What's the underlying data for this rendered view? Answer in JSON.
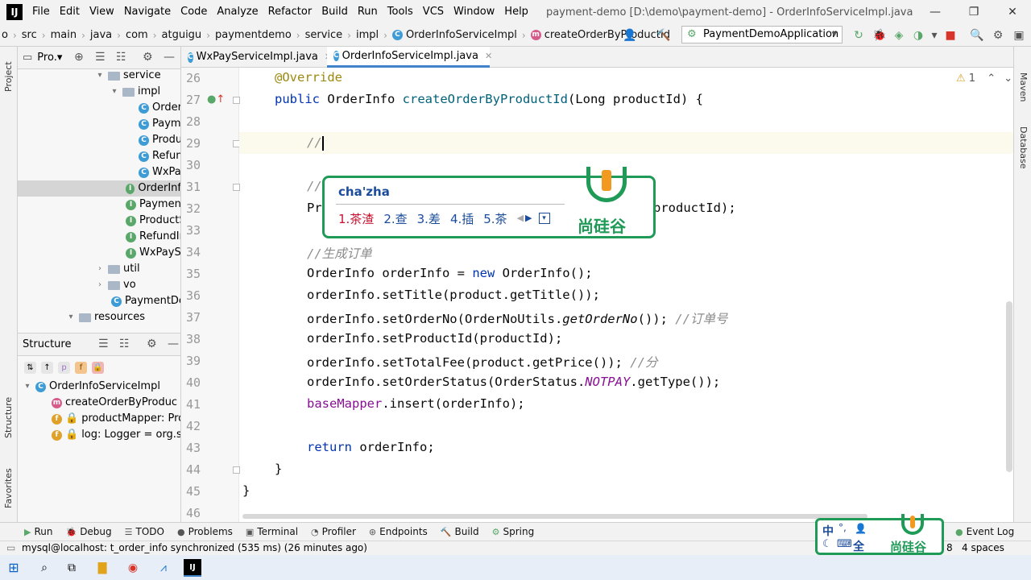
{
  "menu": {
    "items": [
      "File",
      "Edit",
      "View",
      "Navigate",
      "Code",
      "Analyze",
      "Refactor",
      "Build",
      "Run",
      "Tools",
      "VCS",
      "Window",
      "Help"
    ],
    "window_title": "payment-demo [D:\\demo\\payment-demo] - OrderInfoServiceImpl.java"
  },
  "breadcrumb": [
    "o",
    "src",
    "main",
    "java",
    "com",
    "atguigu",
    "paymentdemo",
    "service",
    "impl",
    "OrderInfoServiceImpl",
    "createOrderByProductId"
  ],
  "run_config": "PaymentDemoApplication",
  "left_strip": {
    "project": "Project",
    "structure": "Structure",
    "favorites": "Favorites"
  },
  "right_strip": {
    "maven": "Maven",
    "database": "Database"
  },
  "project_panel": {
    "title": "Pro.▾",
    "rows": [
      {
        "label": "service",
        "kind": "folder",
        "expanded": true
      },
      {
        "label": "impl",
        "kind": "folder",
        "expanded": true
      },
      {
        "label": "Order",
        "kind": "class"
      },
      {
        "label": "Payme",
        "kind": "class"
      },
      {
        "label": "Produ",
        "kind": "class"
      },
      {
        "label": "Refun",
        "kind": "class"
      },
      {
        "label": "WxPa",
        "kind": "class"
      },
      {
        "label": "OrderInf",
        "kind": "interface",
        "selected": true
      },
      {
        "label": "Payment",
        "kind": "interface"
      },
      {
        "label": "ProductS",
        "kind": "interface"
      },
      {
        "label": "RefundIn",
        "kind": "interface"
      },
      {
        "label": "WxPaySe",
        "kind": "interface"
      },
      {
        "label": "util",
        "kind": "folder",
        "expanded": false
      },
      {
        "label": "vo",
        "kind": "folder",
        "expanded": false
      },
      {
        "label": "PaymentDer",
        "kind": "class"
      },
      {
        "label": "resources",
        "kind": "folder",
        "expanded": true
      }
    ]
  },
  "structure_panel": {
    "title": "Structure",
    "rows": [
      {
        "label": "OrderInfoServiceImpl",
        "badge": "C"
      },
      {
        "label": "createOrderByProduc",
        "badge": "m"
      },
      {
        "label": "productMapper: Proc",
        "badge": "f"
      },
      {
        "label": "log: Logger = org.slf",
        "badge": "f"
      }
    ]
  },
  "editor_tabs": [
    {
      "label": "WxPayServiceImpl.java",
      "active": false
    },
    {
      "label": "OrderInfoServiceImpl.java",
      "active": true
    }
  ],
  "editor": {
    "warnings": "1",
    "line_numbers": [
      "26",
      "27",
      "28",
      "29",
      "30",
      "31",
      "32",
      "33",
      "34",
      "35",
      "36",
      "37",
      "38",
      "39",
      "40",
      "41",
      "42",
      "43",
      "44",
      "45",
      "46"
    ],
    "code": {
      "l26": "@Override",
      "l27a": "public ",
      "l27b": "OrderInfo ",
      "l27c": "createOrderByProductId",
      "l27d": "(Long productId) {",
      "l29": "//",
      "l31": "//",
      "l32a": "Pr",
      "l32b": "productId);",
      "l34": "//生成订单",
      "l35a": "OrderInfo orderInfo = ",
      "l35b": "new ",
      "l35c": "OrderInfo();",
      "l36": "orderInfo.setTitle(product.getTitle());",
      "l37a": "orderInfo.setOrderNo(OrderNoUtils.",
      "l37b": "getOrderNo",
      "l37c": "()); ",
      "l37d": "//订单号",
      "l38": "orderInfo.setProductId(productId);",
      "l39a": "orderInfo.setTotalFee(product.getPrice()); ",
      "l39b": "//分",
      "l40a": "orderInfo.setOrderStatus(OrderStatus.",
      "l40b": "NOTPAY",
      "l40c": ".getType());",
      "l41a": "baseMapper",
      "l41b": ".insert(orderInfo);",
      "l43a": "return ",
      "l43b": "orderInfo;",
      "l44": "}",
      "l45": "}"
    }
  },
  "ime_popup": {
    "input": "cha'zha",
    "candidates": [
      "1.茶渣",
      "2.查",
      "3.差",
      "4.插",
      "5.茶"
    ],
    "logo_text": "尚硅谷"
  },
  "bottom_tools": [
    "Run",
    "Debug",
    "TODO",
    "Problems",
    "Terminal",
    "Profiler",
    "Endpoints",
    "Build",
    "Spring",
    "Event Log"
  ],
  "status": {
    "message": "mysql@localhost: t_order_info synchronized (535 ms) (26 minutes ago)",
    "indent": "4 spaces",
    "col": "8"
  },
  "ime_widget": {
    "labels": [
      "中",
      "°,",
      "全"
    ],
    "logo_text": "尚硅谷"
  },
  "colors": {
    "accent": "#4083c9",
    "ime_green": "#1f9a57",
    "logo_orange": "#f29a1f"
  }
}
